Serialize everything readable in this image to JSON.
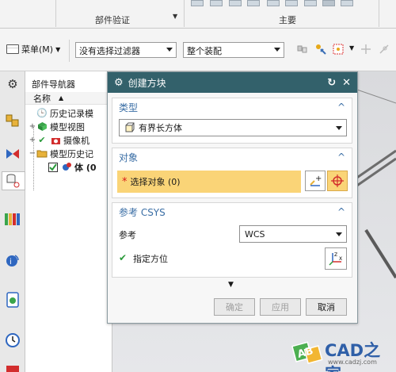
{
  "ribbon": {
    "group_left": "部件验证",
    "group_right": "主要"
  },
  "toolbar": {
    "menu_label": "菜单(M)",
    "filter_value": "没有选择过滤器",
    "scope_value": "整个装配"
  },
  "navigator": {
    "title": "部件导航器",
    "column_name": "名称",
    "tree": [
      {
        "label": "历史记录模",
        "expander": ""
      },
      {
        "label": "模型视图",
        "expander": "+"
      },
      {
        "label": "摄像机",
        "expander": "+"
      },
      {
        "label": "模型历史记",
        "expander": "−"
      },
      {
        "label": "体 (0",
        "expander": ""
      }
    ]
  },
  "dialog": {
    "title": "创建方块",
    "type_section": {
      "label": "类型",
      "value": "有界长方体"
    },
    "object_section": {
      "label": "对象",
      "select_label": "选择对象 (0)"
    },
    "csys_section": {
      "label": "参考 CSYS",
      "reference_label": "参考",
      "reference_value": "WCS",
      "orient_label": "指定方位"
    },
    "buttons": {
      "ok": "确定",
      "apply": "应用",
      "cancel": "取消"
    }
  },
  "watermark": {
    "text": "CAD之家",
    "url": "www.cadzj.com",
    "logo_letters": "AB"
  },
  "colors": {
    "title_bar": "#33616b",
    "highlight": "#fad477",
    "section_header": "#3a6ea5"
  }
}
